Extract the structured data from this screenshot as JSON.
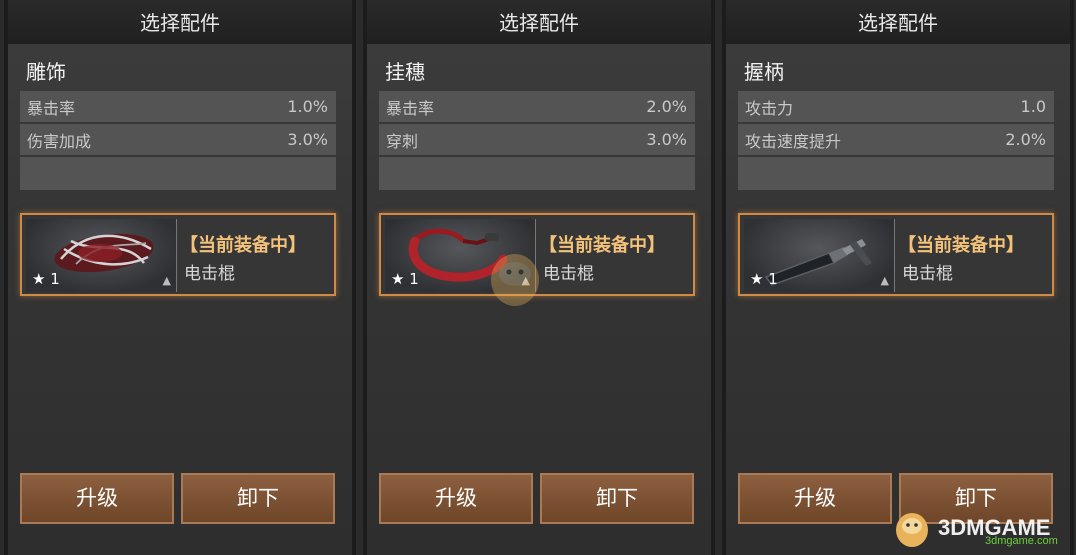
{
  "panels": [
    {
      "title": "选择配件",
      "slot": "雕饰",
      "stats": [
        {
          "label": "暴击率",
          "value": "1.0%"
        },
        {
          "label": "伤害加成",
          "value": "3.0%"
        }
      ],
      "item": {
        "icon": "ornament-icon",
        "stars": "1",
        "status": "【当前装备中】",
        "weapon": "电击棍"
      },
      "buttons": {
        "upgrade": "升级",
        "unequip": "卸下"
      }
    },
    {
      "title": "选择配件",
      "slot": "挂穗",
      "stats": [
        {
          "label": "暴击率",
          "value": "2.0%"
        },
        {
          "label": "穿刺",
          "value": "3.0%"
        }
      ],
      "item": {
        "icon": "tassel-icon",
        "stars": "1",
        "status": "【当前装备中】",
        "weapon": "电击棍"
      },
      "buttons": {
        "upgrade": "升级",
        "unequip": "卸下"
      }
    },
    {
      "title": "选择配件",
      "slot": "握柄",
      "stats": [
        {
          "label": "攻击力",
          "value": "1.0"
        },
        {
          "label": "攻击速度提升",
          "value": "2.0%"
        }
      ],
      "item": {
        "icon": "grip-icon",
        "stars": "1",
        "status": "【当前装备中】",
        "weapon": "电击棍"
      },
      "buttons": {
        "upgrade": "升级",
        "unequip": "卸下"
      }
    }
  ],
  "watermark": {
    "brand": "3DMGAME",
    "url": "3dmgame.com"
  },
  "colors": {
    "accent": "#d18a45",
    "button": "#7d5234",
    "equipped_text": "#f3c27a"
  }
}
